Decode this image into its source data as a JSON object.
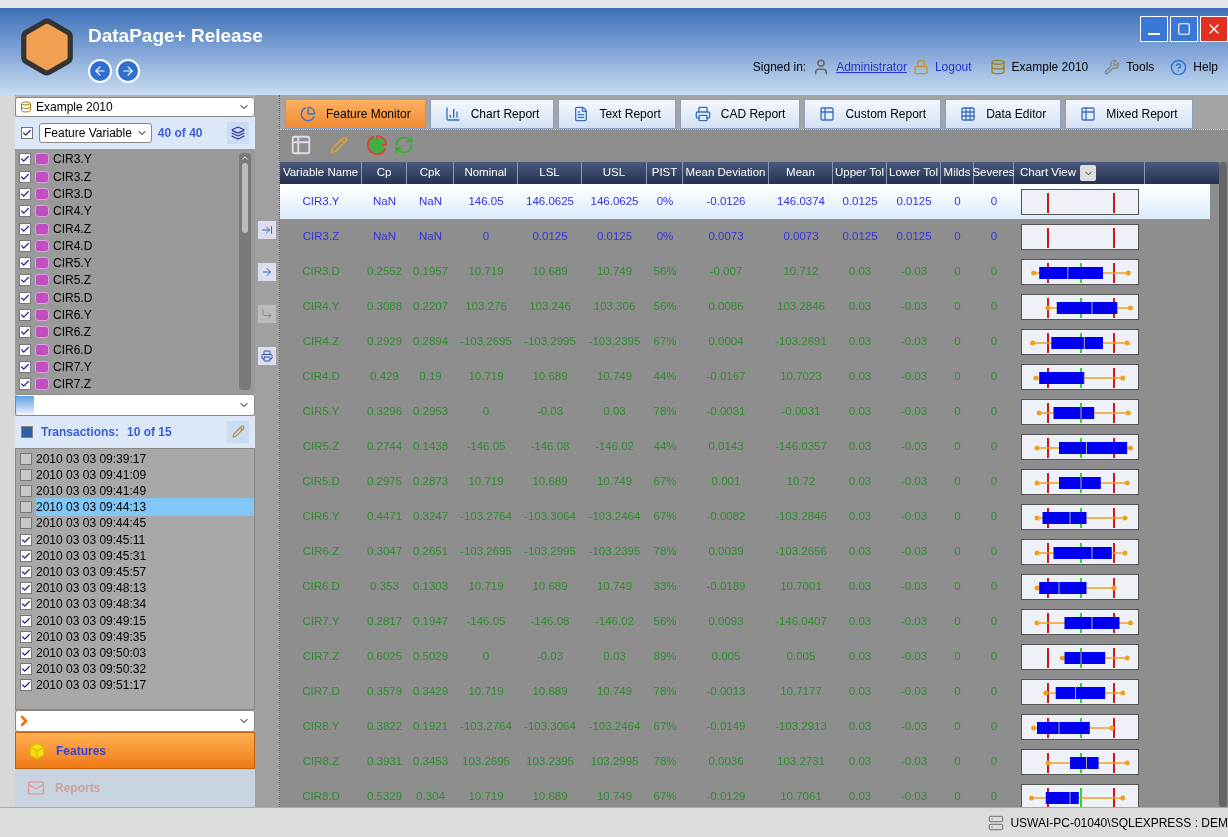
{
  "window": {
    "title": "DataPage+ Release"
  },
  "header": {
    "signed_in_label": "Signed in:",
    "user": "Administrator",
    "logout": "Logout",
    "database": "Example 2010",
    "tools": "Tools",
    "help": "Help"
  },
  "sidebar": {
    "database_select": {
      "value": "Example 2010"
    },
    "feature_filter": {
      "checked": true,
      "select": "Feature Variable",
      "count": "40 of 40"
    },
    "features": [
      {
        "label": "CIR3.Y",
        "checked": true
      },
      {
        "label": "CIR3.Z",
        "checked": true
      },
      {
        "label": "CIR3.D",
        "checked": true
      },
      {
        "label": "CIR4.Y",
        "checked": true
      },
      {
        "label": "CIR4.Z",
        "checked": true
      },
      {
        "label": "CIR4.D",
        "checked": true
      },
      {
        "label": "CIR5.Y",
        "checked": true
      },
      {
        "label": "CIR5.Z",
        "checked": true
      },
      {
        "label": "CIR5.D",
        "checked": true
      },
      {
        "label": "CIR6.Y",
        "checked": true
      },
      {
        "label": "CIR6.Z",
        "checked": true
      },
      {
        "label": "CIR6.D",
        "checked": true
      },
      {
        "label": "CIR7.Y",
        "checked": true
      },
      {
        "label": "CIR7.Z",
        "checked": true
      }
    ],
    "transactions_select_all": {
      "indeterminate": true
    },
    "transactions_label": "Transactions:",
    "transactions_count": "10 of 15",
    "transactions": [
      {
        "label": "2010 03 03 09:39:17",
        "checked": false,
        "selected": false
      },
      {
        "label": "2010 03 03 09:41:09",
        "checked": false,
        "selected": false
      },
      {
        "label": "2010 03 03 09:41:49",
        "checked": false,
        "selected": false
      },
      {
        "label": "2010 03 03 09:44:13",
        "checked": false,
        "selected": true
      },
      {
        "label": "2010 03 03 09:44:45",
        "checked": false,
        "selected": false
      },
      {
        "label": "2010 03 03 09:45:11",
        "checked": true,
        "selected": false
      },
      {
        "label": "2010 03 03 09:45:31",
        "checked": true,
        "selected": false
      },
      {
        "label": "2010 03 03 09:45:57",
        "checked": true,
        "selected": false
      },
      {
        "label": "2010 03 03 09:48:13",
        "checked": true,
        "selected": false
      },
      {
        "label": "2010 03 03 09:48:34",
        "checked": true,
        "selected": false
      },
      {
        "label": "2010 03 03 09:49:15",
        "checked": true,
        "selected": false
      },
      {
        "label": "2010 03 03 09:49:35",
        "checked": true,
        "selected": false
      },
      {
        "label": "2010 03 03 09:50:03",
        "checked": true,
        "selected": false
      },
      {
        "label": "2010 03 03 09:50:32",
        "checked": true,
        "selected": false
      },
      {
        "label": "2010 03 03 09:51:17",
        "checked": true,
        "selected": false
      }
    ],
    "nav": [
      {
        "label": "Features",
        "selected": true
      },
      {
        "label": "Reports",
        "selected": false
      }
    ]
  },
  "tabs": [
    {
      "label": "Feature Monitor",
      "selected": true
    },
    {
      "label": "Chart Report",
      "selected": false
    },
    {
      "label": "Text Report",
      "selected": false
    },
    {
      "label": "CAD Report",
      "selected": false
    },
    {
      "label": "Custom Report",
      "selected": false
    },
    {
      "label": "Data Editor",
      "selected": false
    },
    {
      "label": "Mixed Report",
      "selected": false
    }
  ],
  "table": {
    "columns": [
      "Variable Name",
      "Cp",
      "Cpk",
      "Nominal",
      "LSL",
      "USL",
      "PIST",
      "Mean Deviation",
      "Mean",
      "Upper Tol",
      "Lower Tol",
      "Milds",
      "Severes",
      "Chart View"
    ],
    "rows": [
      {
        "selected": true,
        "color": "#3333dd",
        "kind": "limits",
        "cells": [
          "CIR3.Y",
          "NaN",
          "NaN",
          "146.05",
          "146.0625",
          "146.0625",
          "0%",
          "-0.0126",
          "146.0374",
          "0.0125",
          "0.0125",
          "0",
          "0"
        ]
      },
      {
        "selected": false,
        "color": "#3333dd",
        "kind": "limits",
        "cells": [
          "CIR3.Z",
          "NaN",
          "NaN",
          "0",
          "0.0125",
          "0.0125",
          "0%",
          "0.0073",
          "0.0073",
          "0.0125",
          "0.0125",
          "0",
          "0"
        ]
      },
      {
        "selected": false,
        "color": "#2e8b2e",
        "kind": "box",
        "cells": [
          "CIR3.D",
          "0.2552",
          "0.1957",
          "10.719",
          "10.689",
          "10.749",
          "56%",
          "-0.007",
          "10.712",
          "0.03",
          "-0.03",
          "0",
          "0"
        ]
      },
      {
        "selected": false,
        "color": "#2e8b2e",
        "kind": "box",
        "cells": [
          "CIR4.Y",
          "0.3088",
          "0.2207",
          "103.276",
          "103.246",
          "103.306",
          "56%",
          "0.0086",
          "103.2846",
          "0.03",
          "-0.03",
          "0",
          "0"
        ]
      },
      {
        "selected": false,
        "color": "#2e8b2e",
        "kind": "box",
        "cells": [
          "CIR4.Z",
          "0.2929",
          "0.2894",
          "-103.2695",
          "-103.2995",
          "-103.2395",
          "67%",
          "0.0004",
          "-103.2691",
          "0.03",
          "-0.03",
          "0",
          "0"
        ]
      },
      {
        "selected": false,
        "color": "#2e8b2e",
        "kind": "box",
        "cells": [
          "CIR4.D",
          "0.429",
          "0.19",
          "10.719",
          "10.689",
          "10.749",
          "44%",
          "-0.0167",
          "10.7023",
          "0.03",
          "-0.03",
          "0",
          "0"
        ]
      },
      {
        "selected": false,
        "color": "#2e8b2e",
        "kind": "box",
        "cells": [
          "CIR5.Y",
          "0.3296",
          "0.2953",
          "0",
          "-0.03",
          "0.03",
          "78%",
          "-0.0031",
          "-0.0031",
          "0.03",
          "-0.03",
          "0",
          "0"
        ]
      },
      {
        "selected": false,
        "color": "#2e8b2e",
        "kind": "box",
        "cells": [
          "CIR5.Z",
          "0.2744",
          "0.1438",
          "-146.05",
          "-146.08",
          "-146.02",
          "44%",
          "0.0143",
          "-146.0357",
          "0.03",
          "-0.03",
          "0",
          "0"
        ]
      },
      {
        "selected": false,
        "color": "#2e8b2e",
        "kind": "box",
        "cells": [
          "CIR5.D",
          "0.2975",
          "0.2873",
          "10.719",
          "10.689",
          "10.749",
          "67%",
          "0.001",
          "10.72",
          "0.03",
          "-0.03",
          "0",
          "0"
        ]
      },
      {
        "selected": false,
        "color": "#2e8b2e",
        "kind": "box",
        "cells": [
          "CIR6.Y",
          "0.4471",
          "0.3247",
          "-103.2764",
          "-103.3064",
          "-103.2464",
          "67%",
          "-0.0082",
          "-103.2846",
          "0.03",
          "-0.03",
          "0",
          "0"
        ]
      },
      {
        "selected": false,
        "color": "#2e8b2e",
        "kind": "box",
        "cells": [
          "CIR6.Z",
          "0.3047",
          "0.2651",
          "-103.2695",
          "-103.2995",
          "-103.2395",
          "78%",
          "0.0039",
          "-103.2656",
          "0.03",
          "-0.03",
          "0",
          "0"
        ]
      },
      {
        "selected": false,
        "color": "#2e8b2e",
        "kind": "box",
        "cells": [
          "CIR6.D",
          "0.353",
          "0.1303",
          "10.719",
          "10.689",
          "10.749",
          "33%",
          "-0.0189",
          "10.7001",
          "0.03",
          "-0.03",
          "0",
          "0"
        ]
      },
      {
        "selected": false,
        "color": "#2e8b2e",
        "kind": "box",
        "cells": [
          "CIR7.Y",
          "0.2817",
          "0.1947",
          "-146.05",
          "-146.08",
          "-146.02",
          "56%",
          "0.0093",
          "-146.0407",
          "0.03",
          "-0.03",
          "0",
          "0"
        ]
      },
      {
        "selected": false,
        "color": "#2e8b2e",
        "kind": "box",
        "cells": [
          "CIR7.Z",
          "0.6025",
          "0.5029",
          "0",
          "-0.03",
          "0.03",
          "89%",
          "0.005",
          "0.005",
          "0.03",
          "-0.03",
          "0",
          "0"
        ]
      },
      {
        "selected": false,
        "color": "#2e8b2e",
        "kind": "box",
        "cells": [
          "CIR7.D",
          "0.3579",
          "0.3429",
          "10.719",
          "10.689",
          "10.749",
          "78%",
          "-0.0013",
          "10.7177",
          "0.03",
          "-0.03",
          "0",
          "0"
        ]
      },
      {
        "selected": false,
        "color": "#2e8b2e",
        "kind": "box",
        "cells": [
          "CIR8.Y",
          "0.3822",
          "0.1921",
          "-103.2764",
          "-103.3064",
          "-103.2464",
          "67%",
          "-0.0149",
          "-103.2913",
          "0.03",
          "-0.03",
          "0",
          "0"
        ]
      },
      {
        "selected": false,
        "color": "#2e8b2e",
        "kind": "box",
        "cells": [
          "CIR8.Z",
          "0.3931",
          "0.3453",
          "103.2695",
          "103.2395",
          "103.2995",
          "78%",
          "0.0036",
          "103.2731",
          "0.03",
          "-0.03",
          "0",
          "0"
        ]
      },
      {
        "selected": false,
        "color": "#2e8b2e",
        "kind": "box",
        "cells": [
          "CIR8.D",
          "0.5329",
          "0.304",
          "10.719",
          "10.689",
          "10.749",
          "67%",
          "-0.0129",
          "10.7061",
          "0.03",
          "-0.03",
          "0",
          "0"
        ]
      }
    ]
  },
  "status_bar": {
    "connection": "USWAI-PC-01040\\SQLEXPRESS : DEM"
  }
}
